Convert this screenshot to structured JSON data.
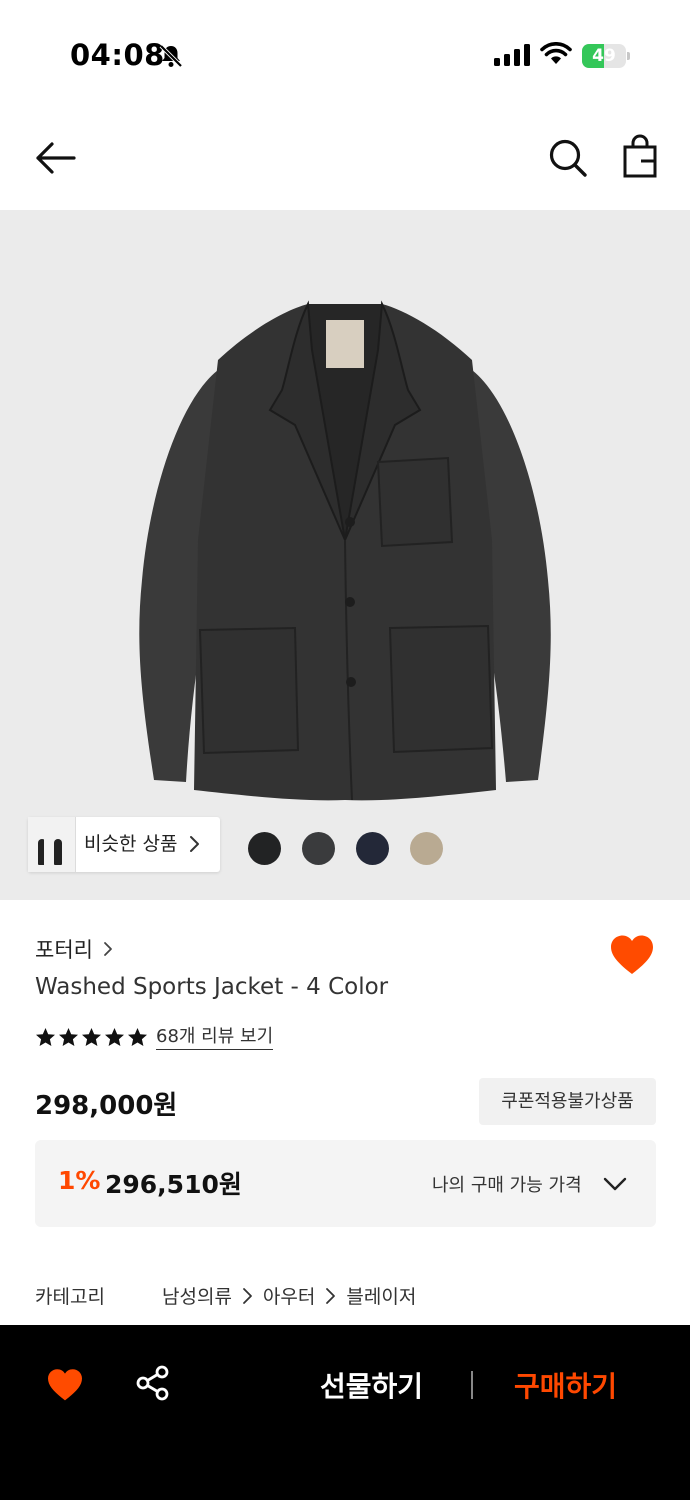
{
  "status_bar": {
    "time": "04:08",
    "battery_level": "49",
    "battery_fraction": 0.49
  },
  "header": {
    "back_icon": "arrow-left-icon",
    "search_icon": "search-icon",
    "cart_icon": "shopping-bag-icon"
  },
  "gallery": {
    "similar_label": "비슷한 상품",
    "colors": [
      "#222324",
      "#3a3b3d",
      "#232838",
      "#b9aa92"
    ]
  },
  "product": {
    "brand": "포터리",
    "title": "Washed Sports Jacket - 4 Color",
    "rating_stars": 5,
    "review_link": "68개 리뷰 보기",
    "price": "298,000원",
    "coupon_badge": "쿠폰적용불가상품",
    "discount_rate": "1%",
    "discount_price": "296,510원",
    "my_price_label": "나의 구매 가능 가격",
    "category_label": "카테고리",
    "category_path": [
      "남성의류",
      "아우터",
      "블레이저"
    ]
  },
  "bottom_bar": {
    "gift_label": "선물하기",
    "buy_label": "구매하기"
  },
  "colors": {
    "accent": "#ff4800",
    "wishlist": "#ff4b00"
  }
}
